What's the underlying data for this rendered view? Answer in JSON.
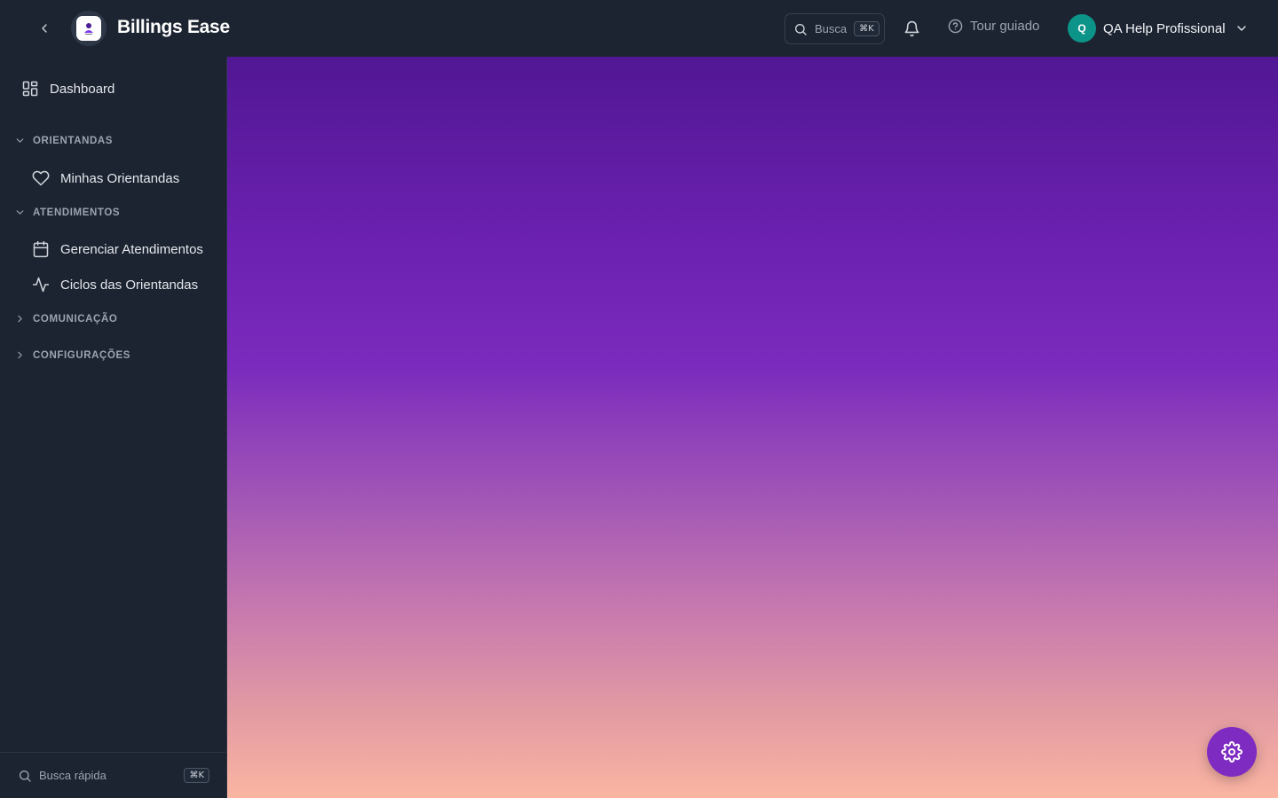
{
  "header": {
    "brand": "Billings Ease",
    "search": {
      "label": "Busca",
      "shortcut": "⌘K"
    },
    "tour_label": "Tour guiado",
    "user": {
      "initial": "Q",
      "name": "QA Help Profissional"
    }
  },
  "sidebar": {
    "dashboard_label": "Dashboard",
    "sections": [
      {
        "title": "ORIENTANDAS",
        "expanded": true,
        "items": [
          {
            "label": "Minhas Orientandas",
            "icon": "heart-icon"
          }
        ]
      },
      {
        "title": "ATENDIMENTOS",
        "expanded": true,
        "items": [
          {
            "label": "Gerenciar Atendimentos",
            "icon": "calendar-icon"
          },
          {
            "label": "Ciclos das Orientandas",
            "icon": "activity-icon"
          }
        ]
      },
      {
        "title": "COMUNICAÇÃO",
        "expanded": false,
        "items": []
      },
      {
        "title": "CONFIGURAÇÕES",
        "expanded": false,
        "items": []
      }
    ],
    "quick_search": {
      "label": "Busca rápida",
      "shortcut": "⌘K"
    }
  },
  "colors": {
    "background": "#1c2432",
    "avatar": "#0d9488",
    "fab": "#7e2bc2",
    "gradient_top": "#511794",
    "gradient_bottom": "#fbb5a2"
  }
}
